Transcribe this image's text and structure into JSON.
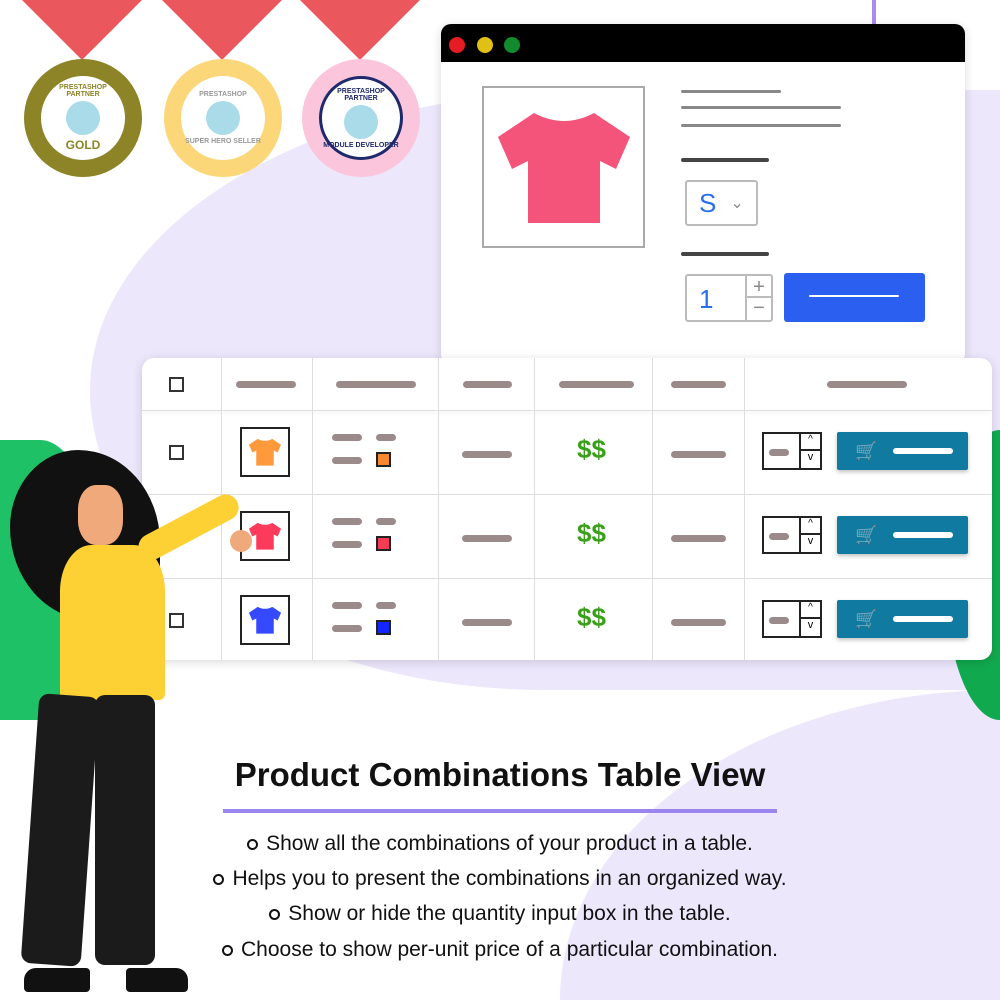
{
  "medals": [
    {
      "name": "PrestaShop Partner Gold",
      "top": "PRESTASHOP PARTNER",
      "bottom": "GOLD",
      "color": "#8c8427"
    },
    {
      "name": "PrestaShop Super Hero Seller",
      "top": "PRESTASHOP",
      "bottom": "SUPER HERO SELLER",
      "color": "#fcd77a"
    },
    {
      "name": "PrestaShop Partner Module Developer",
      "top": "PRESTASHOP PARTNER",
      "bottom": "MODULE DEVELOPER",
      "color": "#fbc6dc"
    }
  ],
  "product_window": {
    "size_value": "S",
    "quantity_value": "1",
    "shirt_color": "#f4547a"
  },
  "table": {
    "rows": [
      {
        "checked": false,
        "shirt_color": "#ff9a3c",
        "swatch": "#f7882d",
        "price": "$$"
      },
      {
        "checked": true,
        "shirt_color": "#fc3b5c",
        "swatch": "#f53b55",
        "price": "$$"
      },
      {
        "checked": false,
        "shirt_color": "#3549ff",
        "swatch": "#1326ff",
        "price": "$$"
      }
    ],
    "cart_color": "#117aa0"
  },
  "title": "Product Combinations Table View",
  "bullets": [
    "Show all the combinations of your product in a table.",
    "Helps you to present the combinations in an organized way.",
    "Show or hide the quantity input box in the table.",
    "Choose to show per-unit price of a particular combination."
  ],
  "colors": {
    "accent": "#9b86f0",
    "background_blob": "#ede7fc",
    "price": "#3aa01a"
  }
}
